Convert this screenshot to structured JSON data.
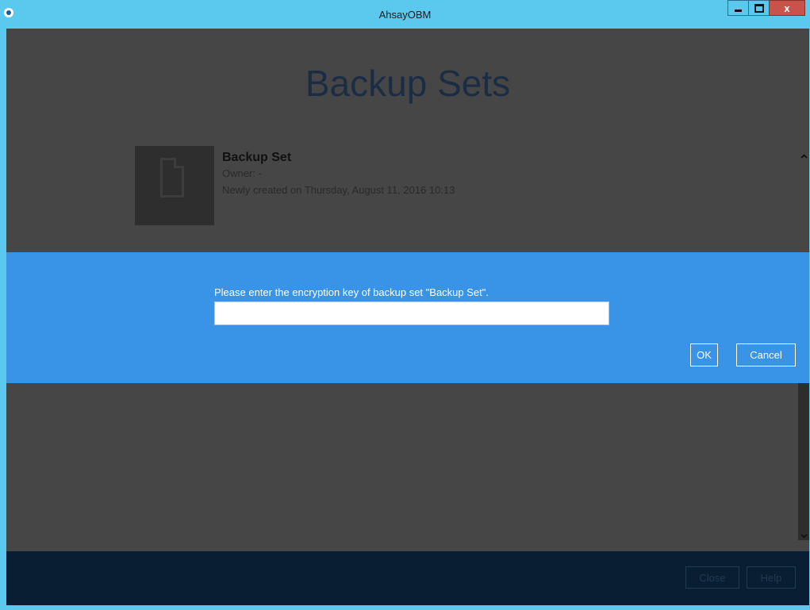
{
  "window": {
    "title": "AhsayOBM",
    "minimize_label": "–",
    "maximize_label": "□",
    "close_label": "x"
  },
  "page": {
    "title": "Backup Sets"
  },
  "backup_set": {
    "name": "Backup Set",
    "owner": "Owner: -",
    "created": "Newly created on Thursday, August 11, 2016 10:13",
    "icon": "document-icon"
  },
  "dialog": {
    "prompt": "Please enter the encryption key of backup set \"Backup Set\".",
    "key_value": "",
    "ok_label": "OK",
    "cancel_label": "Cancel"
  },
  "footer": {
    "close_label": "Close",
    "help_label": "Help"
  },
  "colors": {
    "titlebar": "#5bc8ee",
    "dialog": "#3993e6",
    "overlay": "#464646",
    "footer": "#091d33"
  }
}
